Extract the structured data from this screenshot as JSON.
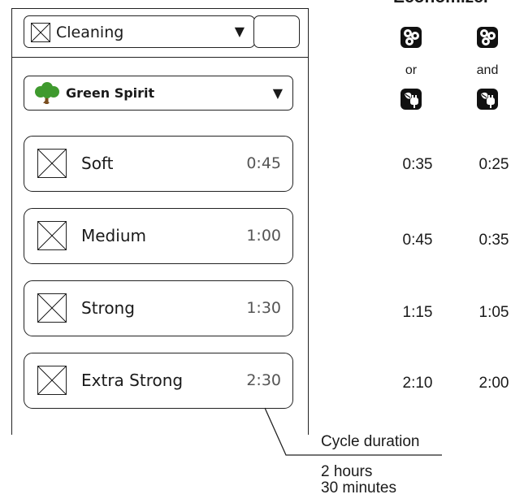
{
  "panel": {
    "cleaning_label": "Cleaning",
    "dropdown_caret": "▼",
    "program_label": "Green Spirit",
    "programs": [
      {
        "label": "Soft",
        "time": "0:45"
      },
      {
        "label": "Medium",
        "time": "1:00"
      },
      {
        "label": "Strong",
        "time": "1:30"
      },
      {
        "label": "Extra Strong",
        "time": "2:30"
      }
    ]
  },
  "economizer": {
    "title": "Economizer",
    "columns": [
      {
        "connector": "or",
        "values": [
          "0:35",
          "0:45",
          "1:15",
          "2:10"
        ]
      },
      {
        "connector": "and",
        "values": [
          "0:25",
          "0:35",
          "1:05",
          "2:00"
        ]
      }
    ]
  },
  "callout": {
    "label": "Cycle duration",
    "line1": "2 hours",
    "line2": "30 minutes"
  },
  "colors": {
    "tree_green": "#3f9a2e",
    "trunk": "#7a4e1f",
    "icon_dark": "#111111"
  }
}
